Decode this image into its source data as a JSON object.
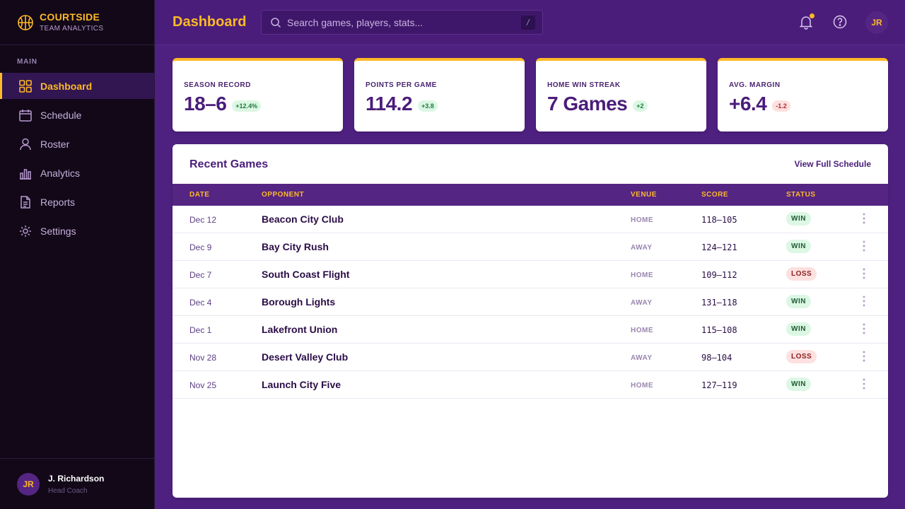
{
  "brand": {
    "name": "COURTSIDE",
    "subtitle": "TEAM ANALYTICS"
  },
  "sidebar": {
    "section_label": "MAIN",
    "items": [
      {
        "label": "Dashboard",
        "icon": "grid-icon",
        "active": true
      },
      {
        "label": "Schedule",
        "icon": "calendar-icon"
      },
      {
        "label": "Roster",
        "icon": "user-icon"
      },
      {
        "label": "Analytics",
        "icon": "bar-chart-icon"
      },
      {
        "label": "Reports",
        "icon": "document-icon"
      },
      {
        "label": "Settings",
        "icon": "gear-icon"
      }
    ]
  },
  "user": {
    "initials": "JR",
    "name": "J. Richardson",
    "role": "Head Coach"
  },
  "header": {
    "title": "Dashboard",
    "search_placeholder": "Search games, players, stats...",
    "search_shortcut": "/",
    "avatar_initials": "JR"
  },
  "stats": [
    {
      "label": "SEASON RECORD",
      "value": "18–6",
      "delta": "+12.4%",
      "trend": "up"
    },
    {
      "label": "POINTS PER GAME",
      "value": "114.2",
      "delta": "+3.8",
      "trend": "up"
    },
    {
      "label": "HOME WIN STREAK",
      "value": "7 Games",
      "delta": "+2",
      "trend": "up"
    },
    {
      "label": "AVG. MARGIN",
      "value": "+6.4",
      "delta": "-1.2",
      "trend": "down"
    }
  ],
  "recent_games": {
    "title": "Recent Games",
    "link": "View Full Schedule",
    "columns": [
      "DATE",
      "OPPONENT",
      "VENUE",
      "SCORE",
      "STATUS"
    ],
    "rows": [
      {
        "date": "Dec 12",
        "opponent": "Beacon City Club",
        "venue": "HOME",
        "score": "118–105",
        "status": "WIN"
      },
      {
        "date": "Dec 9",
        "opponent": "Bay City Rush",
        "venue": "AWAY",
        "score": "124–121",
        "status": "WIN"
      },
      {
        "date": "Dec 7",
        "opponent": "South Coast Flight",
        "venue": "HOME",
        "score": "109–112",
        "status": "LOSS"
      },
      {
        "date": "Dec 4",
        "opponent": "Borough Lights",
        "venue": "AWAY",
        "score": "131–118",
        "status": "WIN"
      },
      {
        "date": "Dec 1",
        "opponent": "Lakefront Union",
        "venue": "HOME",
        "score": "115–108",
        "status": "WIN"
      },
      {
        "date": "Nov 28",
        "opponent": "Desert Valley Club",
        "venue": "AWAY",
        "score": "98–104",
        "status": "LOSS"
      },
      {
        "date": "Nov 25",
        "opponent": "Launch City Five",
        "venue": "HOME",
        "score": "127–119",
        "status": "WIN"
      }
    ]
  },
  "colors": {
    "accent_gold": "#fdb927",
    "brand_purple": "#552583",
    "win": "#1f5a33",
    "loss": "#8a1c1c"
  }
}
